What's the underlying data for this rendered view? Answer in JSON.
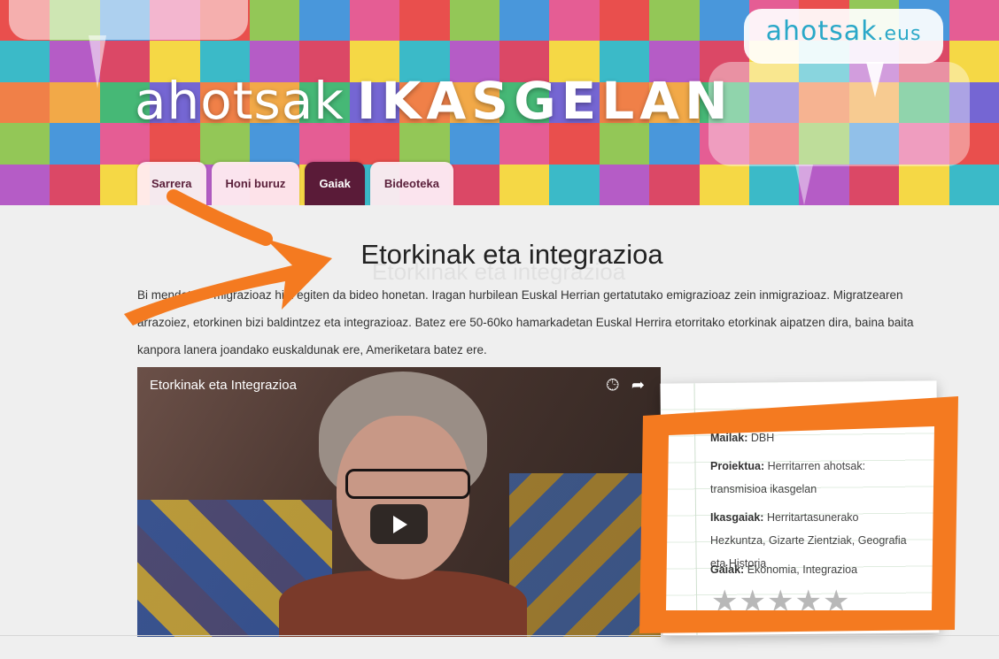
{
  "site": {
    "brand_small": "ahotsak",
    "brand_small_tld": ".eus",
    "logo_thin": "ahotsak",
    "logo_caps": "IKASGELAN"
  },
  "nav": {
    "tabs": [
      {
        "label": "Sarrera",
        "active": false
      },
      {
        "label": "Honi buruz",
        "active": false
      },
      {
        "label": "Gaiak",
        "active": true
      },
      {
        "label": "Bideoteka",
        "active": false
      }
    ]
  },
  "page": {
    "title": "Etorkinak eta integrazioa",
    "description": "Bi mendetako migrazioaz hitz egiten da bideo honetan. Iragan hurbilean Euskal Herrian gertatutako emigrazioaz zein inmigrazioaz. Migratzearen arrazoiez, etorkinen bizi baldintzez eta integrazioaz. Batez ere 50-60ko hamarkadetan Euskal Herrira etorritako etorkinak aipatzen dira, baina baita kanpora lanera joandako euskaldunak ere, Ameriketara batez ere."
  },
  "video": {
    "title": "Etorkinak eta Integrazioa",
    "icons": [
      "clock-icon",
      "share-icon",
      "play-icon"
    ]
  },
  "info": {
    "mailak_label": "Mailak:",
    "mailak_value": "DBH",
    "proiektua_label": "Proiektua:",
    "proiektua_value": "Herritarren ahotsak: transmisioa ikasgelan",
    "ikasgaiak_label": "Ikasgaiak:",
    "ikasgaiak_value": "Herritartasunerako Hezkuntza, Gizarte Zientziak, Geografia eta Historia",
    "gaiak_label": "Gaiak:",
    "gaiak_value": "Ekonomia, Integrazioa",
    "rating_stars": 5,
    "rating_filled": 0
  },
  "colors": {
    "nav_active": "#5a1b38",
    "brand_blue": "#2aa8c8",
    "annotation_orange": "#f47a20"
  }
}
